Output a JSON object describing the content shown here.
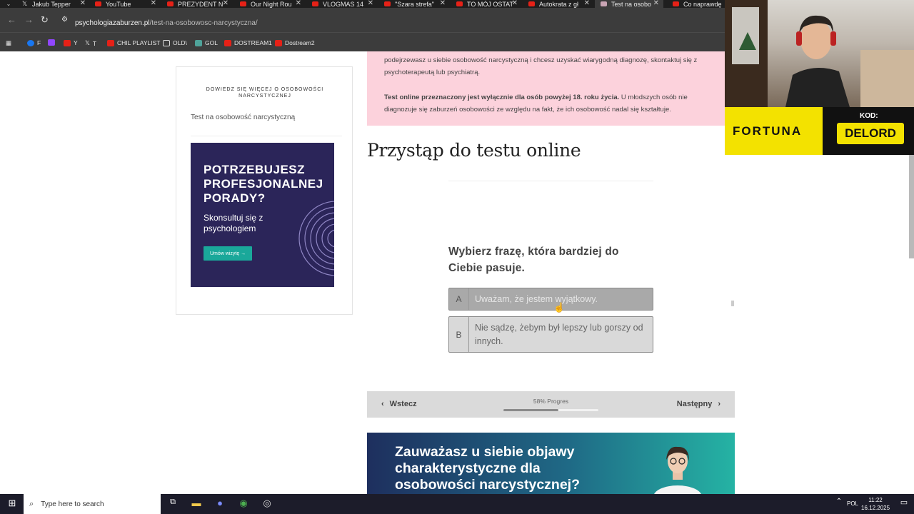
{
  "tabs": [
    {
      "label": "Jakub Tepper",
      "icon": "x-icon"
    },
    {
      "label": "YouTube",
      "icon": "youtube-icon"
    },
    {
      "label": "PREZYDENT N",
      "icon": "youtube-icon"
    },
    {
      "label": "Our Night Rou",
      "icon": "youtube-icon"
    },
    {
      "label": "VLOGMAS 14",
      "icon": "youtube-icon"
    },
    {
      "label": "\"Szara strefa\"",
      "icon": "youtube-icon"
    },
    {
      "label": "TO MÓJ OSTAT",
      "icon": "youtube-icon"
    },
    {
      "label": "Autokrata z gł",
      "icon": "youtube-icon"
    },
    {
      "label": "Test na osobo",
      "icon": "site-icon"
    },
    {
      "label": "Co naprawdę",
      "icon": "youtube-icon"
    }
  ],
  "url": {
    "domain": "psychologiazaburzen.pl",
    "path": "/test-na-osobowosc-narcystyczna/"
  },
  "bookmarks": [
    "F",
    "Y",
    "T",
    "CHIL PLAYLIST",
    "OLD\\",
    "GOL",
    "DOSTREAM1",
    "Dostream2"
  ],
  "sidebar": {
    "heading": "DOWIEDZ SIĘ WIĘCEJ O OSOBOWOŚCI NARCYSTYCZNEJ",
    "link": "Test na osobowość narcystyczną"
  },
  "ad1": {
    "headline_1": "POTRZEBUJESZ",
    "headline_2": "PROFESJONALNEJ",
    "headline_3": "PORADY?",
    "sub_1": "Skonsultuj się z",
    "sub_2": "psychologiem",
    "button": "Umów wizytę  →"
  },
  "notice": {
    "p1": "podejrzewasz u siebie osobowość narcystyczną i chcesz uzyskać wiarygodną diagnozę, skontaktuj się z psychoterapeutą lub psychiatrą.",
    "p2_bold": "Test online przeznaczony jest wyłącznie dla osób powyżej 18. roku życia.",
    "p2_rest": " U młodszych osób nie diagnozuje się zaburzeń osobowości ze względu na fakt, że ich osobowość nadal się kształtuje."
  },
  "test_title": "Przystąp do testu online",
  "question": "Wybierz frazę, która bardziej do Ciebie pasuje.",
  "options": [
    {
      "letter": "A",
      "text": "Uważam, że jestem wyjątkowy."
    },
    {
      "letter": "B",
      "text": "Nie sądzę, żebym był lepszy lub gorszy od innych."
    }
  ],
  "nav": {
    "prev": "Wstecz",
    "next": "Następny",
    "progress_label": "58% Progres",
    "progress": 0.58
  },
  "ad2": {
    "line1": "Zauważasz u siebie objawy",
    "line2": "charakterystyczne dla",
    "line3": "osobowości narcystycznej?"
  },
  "overlay": {
    "brand": "FORTUNA",
    "code_label": "KOD:",
    "code": "DELORD"
  },
  "taskbar": {
    "search_placeholder": "Type here to search",
    "lang": "POL",
    "time": "11:22",
    "date": "16.12.2025"
  }
}
